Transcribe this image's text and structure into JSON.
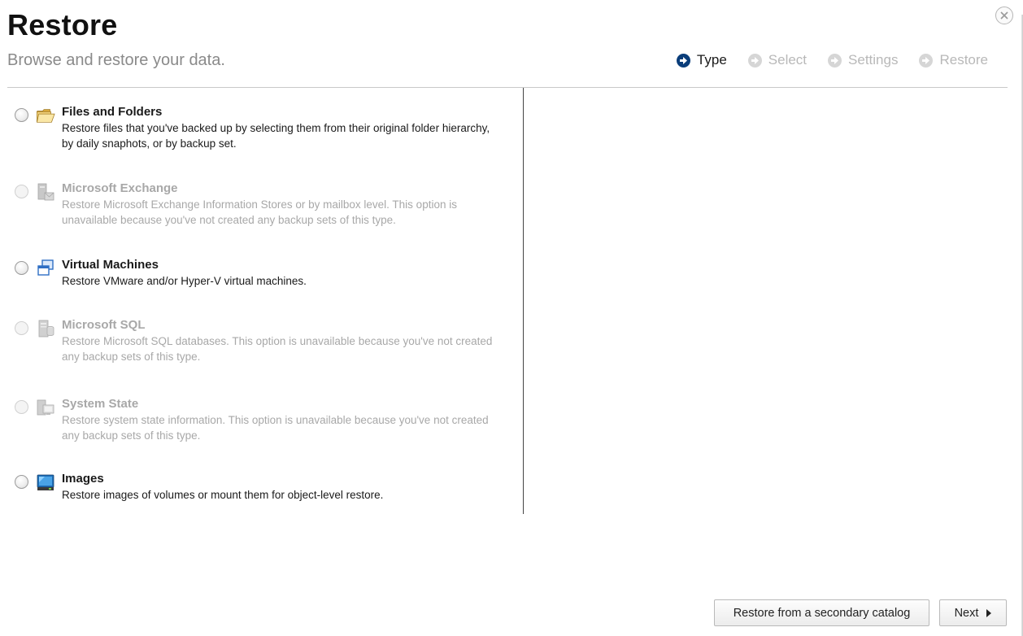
{
  "header": {
    "title": "Restore",
    "subtitle": "Browse and restore your data."
  },
  "wizard": {
    "steps": [
      {
        "label": "Type",
        "active": true
      },
      {
        "label": "Select",
        "active": false
      },
      {
        "label": "Settings",
        "active": false
      },
      {
        "label": "Restore",
        "active": false
      }
    ]
  },
  "options": [
    {
      "title": "Files and Folders",
      "description": "Restore files that you've backed up by selecting them from their original folder hierarchy, by daily snaphots, or by backup set.",
      "enabled": true,
      "icon": "folder-icon"
    },
    {
      "title": "Microsoft Exchange",
      "description": "Restore Microsoft Exchange Information Stores or by mailbox level. This option is unavailable because you've not created any backup sets of this type.",
      "enabled": false,
      "icon": "exchange-server-icon"
    },
    {
      "title": "Virtual Machines",
      "description": "Restore VMware and/or Hyper-V virtual machines.",
      "enabled": true,
      "icon": "virtual-machines-icon"
    },
    {
      "title": "Microsoft SQL",
      "description": "Restore Microsoft SQL databases. This option is unavailable because you've not created any backup sets of this type.",
      "enabled": false,
      "icon": "sql-server-icon"
    },
    {
      "title": "System State",
      "description": "Restore system state information. This option is unavailable because you've not created any backup sets of this type.",
      "enabled": false,
      "icon": "system-state-icon"
    },
    {
      "title": "Images",
      "description": "Restore images of volumes or mount them for object-level restore.",
      "enabled": true,
      "icon": "disk-image-icon"
    }
  ],
  "footer": {
    "secondary_catalog_label": "Restore from a secondary catalog",
    "next_label": "Next"
  },
  "colors": {
    "accent": "#0a3d7a",
    "disabled_text": "#a8a8a8",
    "subtitle": "#8a8a8a"
  }
}
